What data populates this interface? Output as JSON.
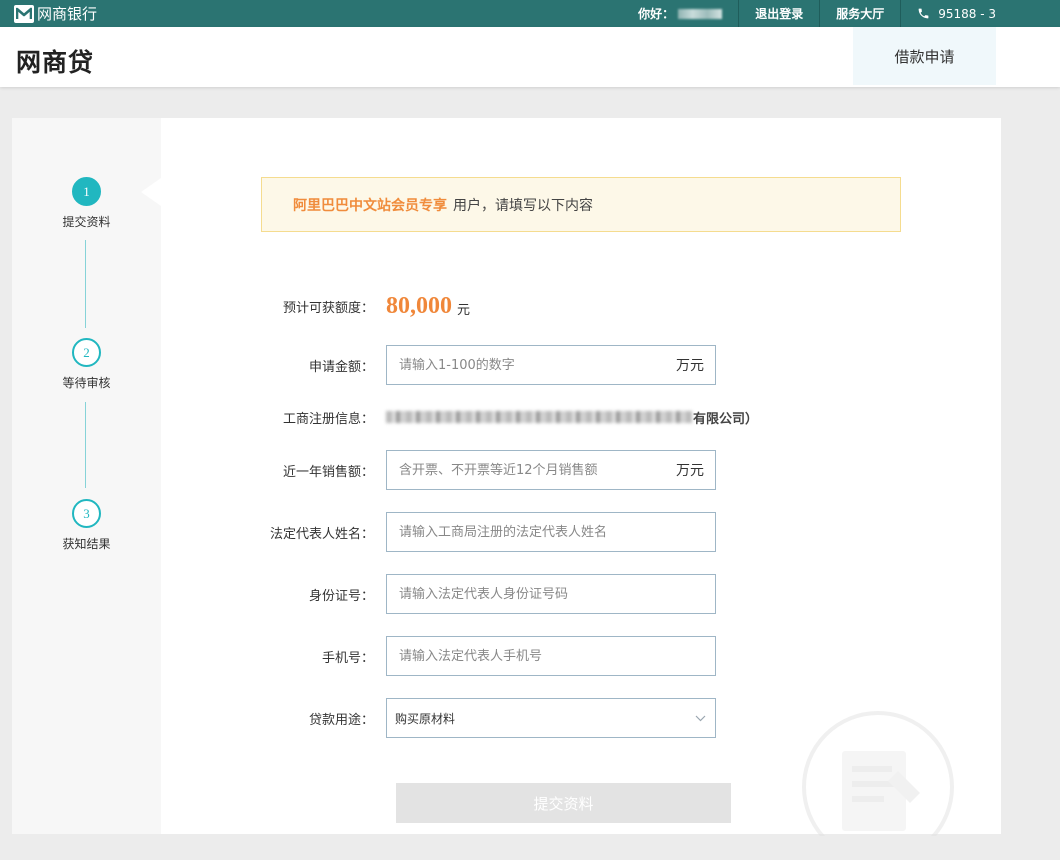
{
  "topbar": {
    "brand": "网商银行",
    "greeting": "你好：",
    "logout": "退出登录",
    "service_hall": "服务大厅",
    "hotline": "95188 - 3"
  },
  "header": {
    "logo": "网商贷",
    "tab": "借款申请"
  },
  "steps": [
    {
      "number": "1",
      "label": "提交资料",
      "active": true
    },
    {
      "number": "2",
      "label": "等待审核",
      "active": false
    },
    {
      "number": "3",
      "label": "获知结果",
      "active": false
    }
  ],
  "notice": {
    "highlight": "阿里巴巴中文站会员专享",
    "text": "用户，请填写以下内容"
  },
  "form": {
    "quota": {
      "label": "预计可获额度：",
      "value": "80,000",
      "unit": "元"
    },
    "amount": {
      "label": "申请金额：",
      "placeholder": "请输入1-100的数字",
      "unit": "万元"
    },
    "registration": {
      "label": "工商注册信息：",
      "suffix": "有限公司）"
    },
    "sales": {
      "label": "近一年销售额：",
      "placeholder": "含开票、不开票等近12个月销售额",
      "unit": "万元"
    },
    "legal_name": {
      "label": "法定代表人姓名：",
      "placeholder": "请输入工商局注册的法定代表人姓名"
    },
    "id_number": {
      "label": "身份证号：",
      "placeholder": "请输入法定代表人身份证号码"
    },
    "phone": {
      "label": "手机号：",
      "placeholder": "请输入法定代表人手机号"
    },
    "purpose": {
      "label": "贷款用途：",
      "selected": "购买原材料"
    },
    "submit_label": "提交资料"
  },
  "colors": {
    "topbar": "#2b7472",
    "accent": "#21b7c0",
    "quota": "#f0873a"
  },
  "icons": [
    "brand-logo-icon",
    "phone-icon",
    "chevron-down-icon",
    "document-watermark-icon"
  ]
}
